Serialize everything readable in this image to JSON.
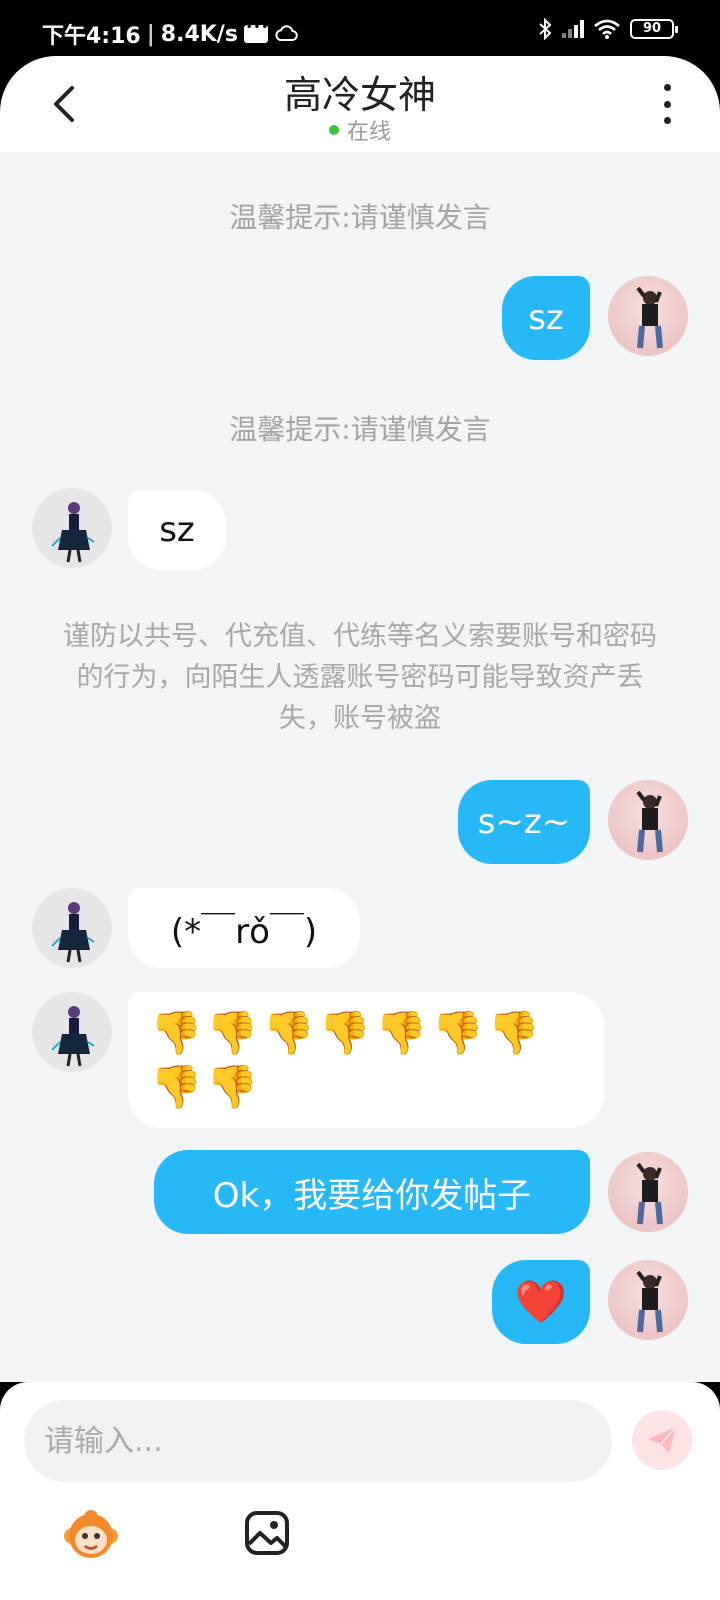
{
  "status_bar": {
    "time": "下午4:16",
    "net_speed": "8.4K/s",
    "battery": "90"
  },
  "header": {
    "title": "高冷女神",
    "online_status": "在线"
  },
  "chat": {
    "tips": [
      "温馨提示:请谨慎发言",
      "温馨提示:请谨慎发言"
    ],
    "warning": "谨防以共号、代充值、代练等名义索要账号和密码的行为，向陌生人透露账号密码可能导致资产丢失，账号被盗",
    "messages": [
      {
        "from": "me",
        "text": "sz"
      },
      {
        "from": "her",
        "text": "sz"
      },
      {
        "from": "me",
        "text": "s~z~"
      },
      {
        "from": "her",
        "text": "(*￣rǒ￣)"
      },
      {
        "from": "her",
        "emoji": "👎",
        "emoji_count": 9
      },
      {
        "from": "me",
        "text": "Ok，我要给你发帖子"
      },
      {
        "from": "me",
        "text": "❤️"
      }
    ]
  },
  "input": {
    "placeholder": "请输入..."
  },
  "colors": {
    "my_bubble": "#27b8f7",
    "her_bubble": "#ffffff",
    "online_dot": "#39c13a",
    "chat_bg": "#f3f4f6"
  },
  "icons": [
    "back-icon",
    "more-icon",
    "send-icon",
    "monkey-emoji-icon",
    "image-icon"
  ]
}
